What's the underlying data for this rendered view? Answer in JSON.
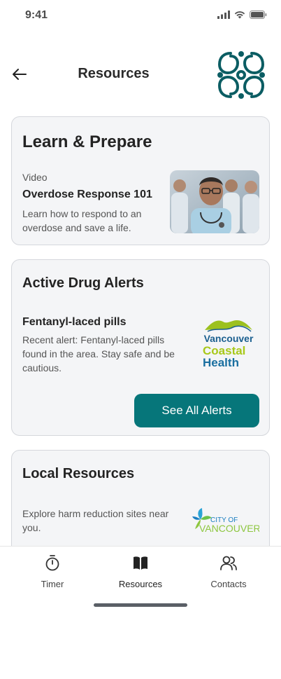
{
  "status_bar": {
    "time": "9:41"
  },
  "header": {
    "title": "Resources"
  },
  "learn": {
    "title": "Learn & Prepare",
    "video_type": "Video",
    "video_title": "Overdose Response 101",
    "video_desc": "Learn how to respond to an overdose and save a life."
  },
  "alerts": {
    "title": "Active Drug Alerts",
    "alert_title": "Fentanyl-laced pills",
    "alert_desc": "Recent alert: Fentanyl-laced pills found in the area. Stay safe and be cautious.",
    "button_label": "See All Alerts",
    "partner_logo_text": [
      "Vancouver",
      "Coastal",
      "Health"
    ]
  },
  "local": {
    "title": "Local Resources",
    "desc": "Explore harm reduction sites near you.",
    "partner_logo_text": [
      "CITY OF",
      "VANCOUVER"
    ]
  },
  "nav": {
    "items": [
      {
        "label": "Timer",
        "icon": "stopwatch-icon"
      },
      {
        "label": "Resources",
        "icon": "book-icon",
        "active": true
      },
      {
        "label": "Contacts",
        "icon": "people-icon"
      }
    ]
  },
  "colors": {
    "accent": "#06767a",
    "card_bg": "#f4f5f7",
    "logo_teal": "#0b5d63"
  }
}
